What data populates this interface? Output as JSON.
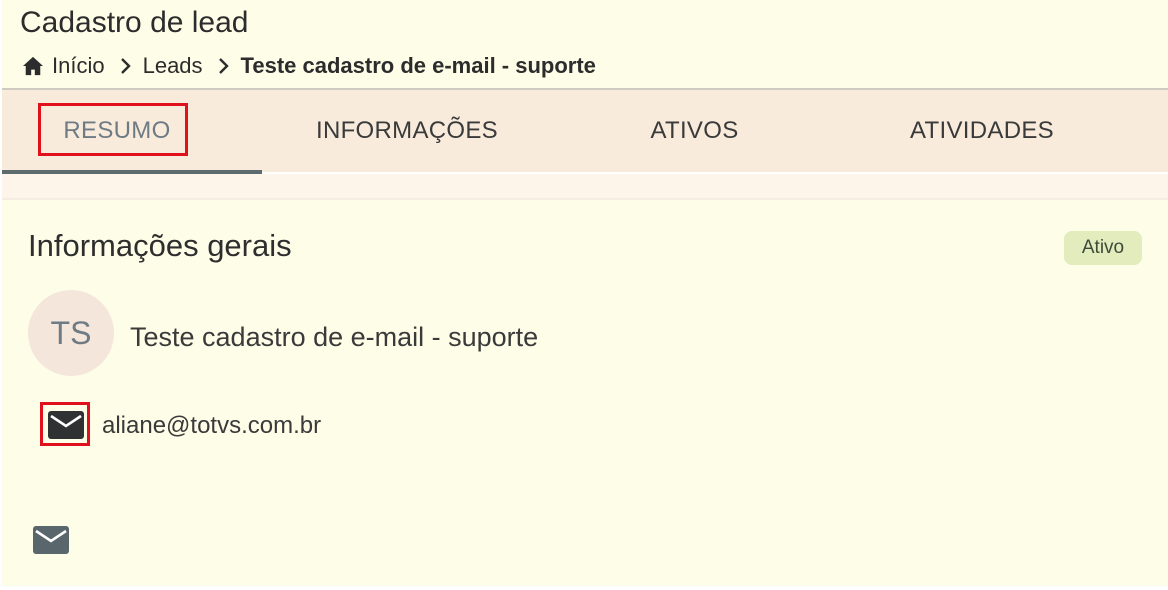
{
  "header": {
    "title": "Cadastro de lead",
    "breadcrumb": {
      "home_icon": "home-icon",
      "items": [
        "Início",
        "Leads",
        "Teste cadastro de e-mail - suporte"
      ],
      "separator_icon": "chevron-right-icon"
    }
  },
  "tabs": [
    {
      "label": "RESUMO",
      "active": true
    },
    {
      "label": "INFORMAÇÕES",
      "active": false
    },
    {
      "label": "ATIVOS",
      "active": false
    },
    {
      "label": "ATIVIDADES",
      "active": false
    }
  ],
  "card": {
    "title": "Informações gerais",
    "status": "Ativo",
    "avatar_initials": "TS",
    "lead_name": "Teste cadastro de e-mail - suporte",
    "email_icon": "mail-icon",
    "email": "aliane@totvs.com.br",
    "bottom_icon": "mail-icon"
  },
  "colors": {
    "highlight": "#e0101c",
    "header_bg": "#fdfde8",
    "tabs_bg": "#f8ebdc",
    "status_bg": "#e3ecbd",
    "avatar_bg": "#f4e6da"
  }
}
